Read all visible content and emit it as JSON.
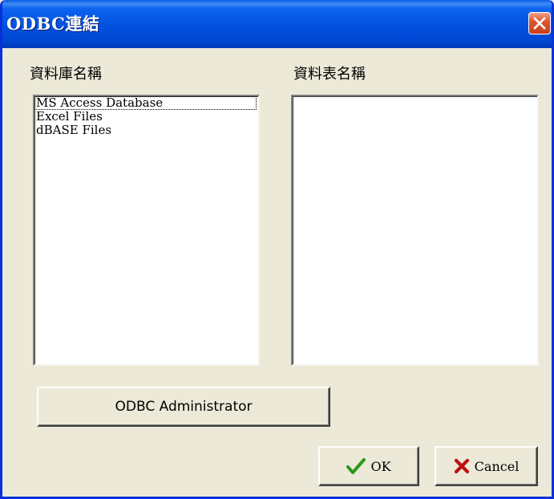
{
  "window": {
    "title": "ODBC連結"
  },
  "database_panel": {
    "label": "資料庫名稱",
    "items": [
      "MS Access Database",
      "Excel Files",
      "dBASE Files"
    ]
  },
  "table_panel": {
    "label": "資料表名稱",
    "items": []
  },
  "buttons": {
    "odbc_admin_label": "ODBC Administrator",
    "ok_label": "OK",
    "cancel_label": "Cancel"
  },
  "colors": {
    "titlebar": "#0251de",
    "window_bg": "#ece9d8",
    "close_button": "#e0552f",
    "ok_check": "#2a9a1a",
    "cancel_x": "#c01010"
  },
  "icons": {
    "close": "close-icon",
    "ok": "checkmark-icon",
    "cancel": "cross-icon"
  }
}
